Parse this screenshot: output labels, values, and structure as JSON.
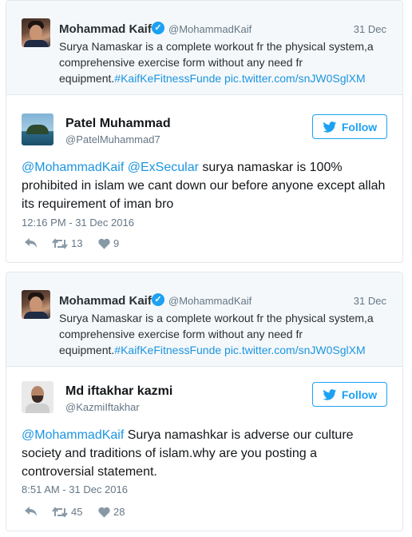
{
  "tweets": [
    {
      "quoted": {
        "name": "Mohammad Kaif",
        "verified": "✓",
        "handle": "@MohammadKaif",
        "date": "31 Dec",
        "text": "Surya Namaskar is a complete workout fr the physical system,a comprehensive exercise form without any need fr equipment.",
        "hashtag": "#KaifKeFitnessFunde",
        "link": "pic.twitter.com/snJW0SglXM"
      },
      "reply": {
        "name": "Patel Muhammad",
        "handle": "@PatelMuhammad7",
        "follow_label": "Follow",
        "mentions": [
          "@MohammadKaif",
          "@ExSecular"
        ],
        "text": "surya namaskar is 100% prohibited in islam we cant down our before anyone except allah its requirement of iman bro",
        "time": "12:16 PM - 31 Dec 2016",
        "retweets": "13",
        "likes": "9"
      }
    },
    {
      "quoted": {
        "name": "Mohammad Kaif",
        "verified": "✓",
        "handle": "@MohammadKaif",
        "date": "31 Dec",
        "text": "Surya Namaskar is a complete workout fr the physical system,a comprehensive exercise form without any need fr equipment.",
        "hashtag": "#KaifKeFitnessFunde",
        "link": "pic.twitter.com/snJW0SglXM"
      },
      "reply": {
        "name": "Md iftakhar kazmi",
        "handle": "@KazmiIftakhar",
        "follow_label": "Follow",
        "mentions": [
          "@MohammadKaif"
        ],
        "text": "Surya namashkar is adverse our culture society and traditions of islam.why are you posting a controversial statement.",
        "time": "8:51 AM - 31 Dec 2016",
        "retweets": "45",
        "likes": "28"
      }
    }
  ],
  "colors": {
    "link": "#1b95e0",
    "follow": "#1da1f2",
    "muted": "#657786"
  }
}
